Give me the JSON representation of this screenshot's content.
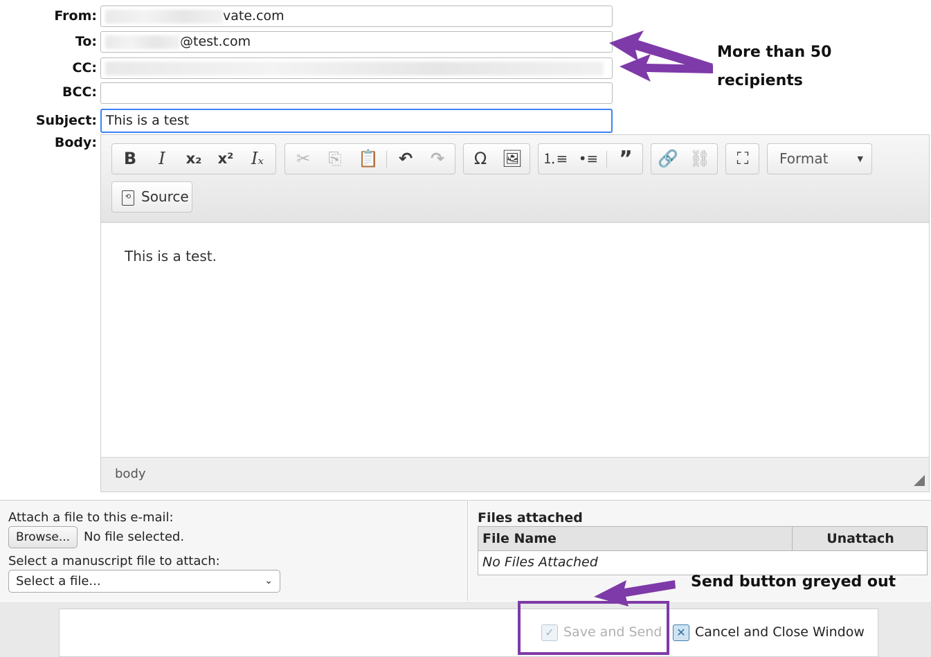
{
  "fields": {
    "from_label": "From:",
    "from_value": "vate.com",
    "to_label": "To:",
    "to_value": "@test.com",
    "cc_label": "CC:",
    "bcc_label": "BCC:",
    "bcc_value": "",
    "subject_label": "Subject:",
    "subject_value": "This is a test",
    "body_label": "Body:"
  },
  "editor": {
    "toolbar": {
      "basic": [
        "B",
        "I",
        "x₂",
        "x²",
        "Iₓ"
      ],
      "format_label": "Format",
      "source_label": "Source"
    },
    "content": "This is a test.",
    "status_path": "body"
  },
  "attach": {
    "label": "Attach a file to this e-mail:",
    "browse_label": "Browse...",
    "no_file_text": "No file selected.",
    "manuscript_label": "Select a manuscript file to attach:",
    "manuscript_select_value": "Select a file..."
  },
  "files": {
    "title": "Files attached",
    "col_name": "File Name",
    "col_unattach": "Unattach",
    "empty_text": "No Files Attached"
  },
  "actions": {
    "save_send_label": "Save and Send",
    "cancel_label": "Cancel and Close Window"
  },
  "annotations": {
    "recipients_line1": "More than 50",
    "recipients_line2": "recipients",
    "send_note": "Send button greyed out",
    "arrow_color": "#7e3aa8"
  }
}
